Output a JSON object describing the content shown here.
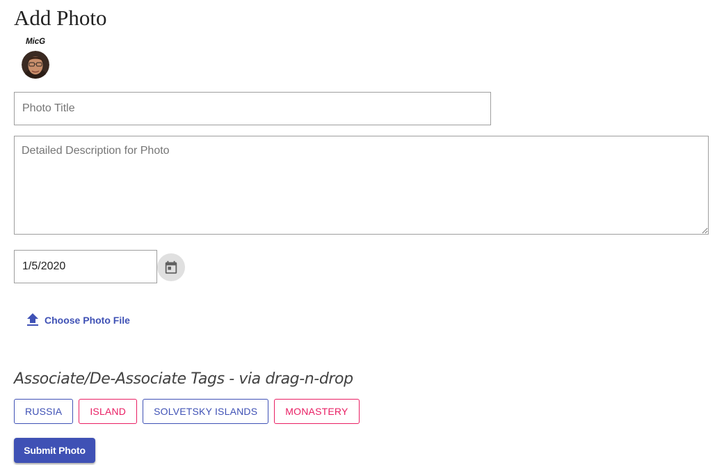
{
  "page": {
    "title": "Add Photo"
  },
  "user": {
    "name": "MicG"
  },
  "form": {
    "title_placeholder": "Photo Title",
    "title_value": "",
    "description_placeholder": "Detailed Description for Photo",
    "description_value": "",
    "date_value": "1/5/2020",
    "calendar_icon": "calendar-icon",
    "choose_file_label": "Choose Photo File",
    "upload_icon": "upload-arrow-icon"
  },
  "tags_section": {
    "heading": "Associate/De-Associate Tags - via drag-n-drop",
    "tags": [
      {
        "label": "RUSSIA",
        "color": "primary"
      },
      {
        "label": "ISLAND",
        "color": "secondary"
      },
      {
        "label": "SOLVETSKY ISLANDS",
        "color": "primary"
      },
      {
        "label": "MONASTERY",
        "color": "secondary"
      }
    ]
  },
  "actions": {
    "submit_label": "Submit Photo"
  },
  "colors": {
    "primary": "#3f51b5",
    "secondary": "#e91e63",
    "border": "#9e9e9e",
    "placeholder": "#757575"
  }
}
